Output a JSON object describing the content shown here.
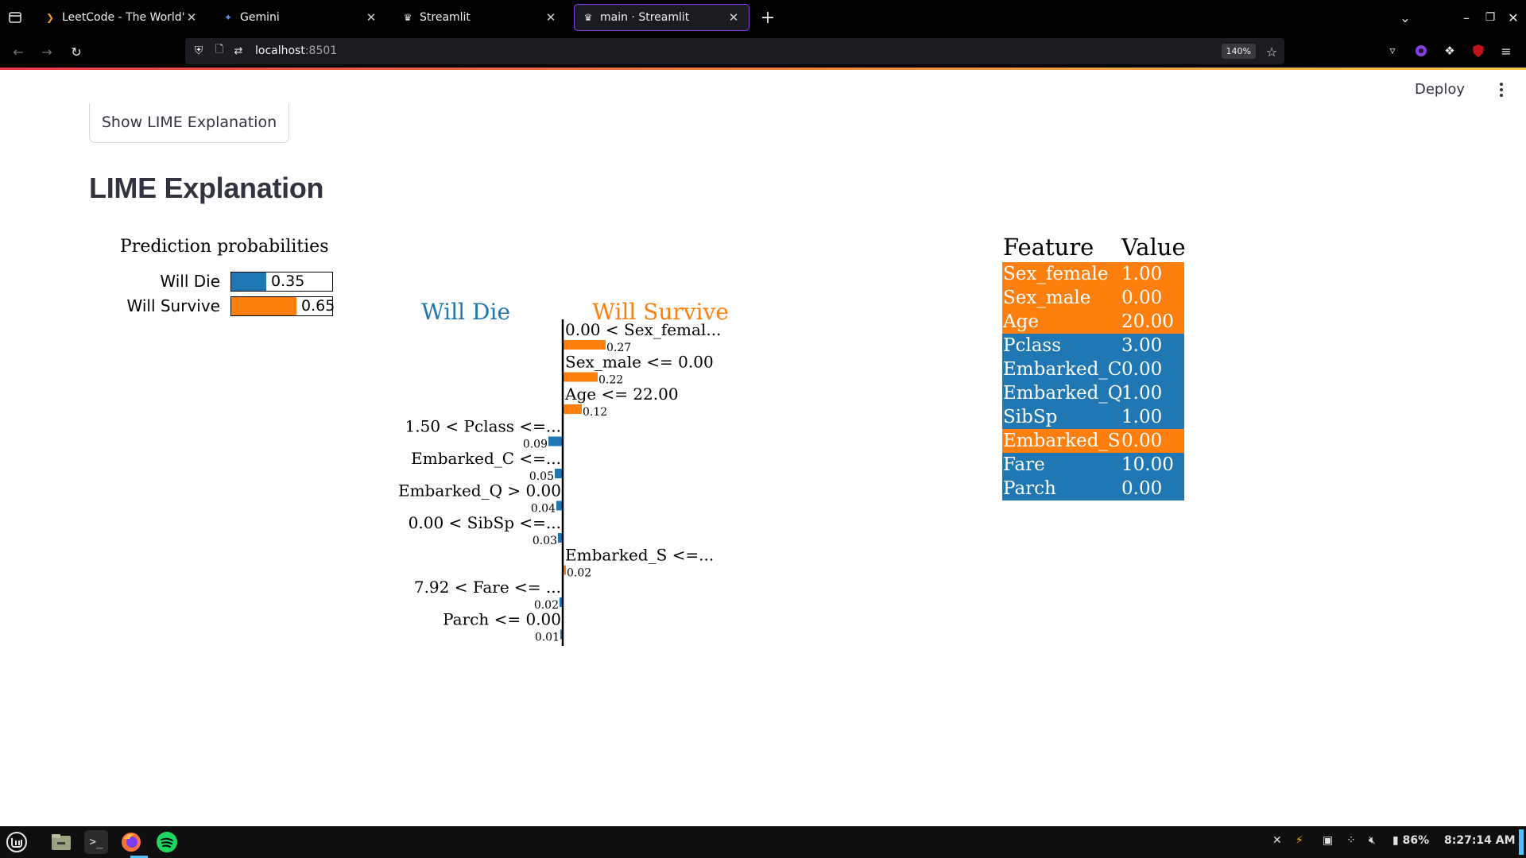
{
  "browser": {
    "tabs": [
      {
        "title": "LeetCode - The World's Leading",
        "favicon": "leetcode-icon"
      },
      {
        "title": "Gemini",
        "favicon": "gemini-icon"
      },
      {
        "title": "Streamlit",
        "favicon": "streamlit-icon"
      },
      {
        "title": "main · Streamlit",
        "favicon": "streamlit-icon"
      }
    ],
    "new_tab": "+",
    "url_host": "localhost",
    "url_port": ":8501",
    "zoom": "140%"
  },
  "app": {
    "deploy_label": "Deploy",
    "lime_button_label": "Show LIME Explanation",
    "heading": "LIME Explanation"
  },
  "lime": {
    "prob_title": "Prediction probabilities",
    "classes": [
      {
        "name": "Will Die",
        "prob": 0.35,
        "prob_label": "0.35",
        "color": "#1f77b4"
      },
      {
        "name": "Will Survive",
        "prob": 0.65,
        "prob_label": "0.65",
        "color": "#ff7f0e"
      }
    ],
    "negative_class": "Will Die",
    "positive_class": "Will Survive",
    "negative_color": "#1f77b4",
    "positive_color": "#ff7f0e"
  },
  "chart_data": {
    "type": "bar",
    "orientation": "horizontal-diverging",
    "categories": [
      "0.00 < Sex_femal...",
      "Sex_male <= 0.00",
      "Age <= 22.00",
      "1.50 < Pclass <=...",
      "Embarked_C <=...",
      "Embarked_Q > 0.00",
      "0.00 < SibSp <=...",
      "Embarked_S <=...",
      "7.92 < Fare <= ...",
      "Parch <= 0.00"
    ],
    "values": [
      0.27,
      0.22,
      0.12,
      -0.09,
      -0.05,
      -0.04,
      -0.03,
      0.02,
      -0.02,
      -0.01
    ],
    "value_labels": [
      "0.27",
      "0.22",
      "0.12",
      "0.09",
      "0.05",
      "0.04",
      "0.03",
      "0.02",
      "0.02",
      "0.01"
    ],
    "series": [
      {
        "name": "Will Die",
        "color": "#1f77b4"
      },
      {
        "name": "Will Survive",
        "color": "#ff7f0e"
      }
    ]
  },
  "feature_table": {
    "headers": [
      "Feature",
      "Value"
    ],
    "rows": [
      {
        "feature": "Sex_female",
        "value": "1.00",
        "color": "#ff7f0e"
      },
      {
        "feature": "Sex_male",
        "value": "0.00",
        "color": "#ff7f0e"
      },
      {
        "feature": "Age",
        "value": "20.00",
        "color": "#ff7f0e"
      },
      {
        "feature": "Pclass",
        "value": "3.00",
        "color": "#1f77b4"
      },
      {
        "feature": "Embarked_C",
        "value": "0.00",
        "color": "#1f77b4"
      },
      {
        "feature": "Embarked_Q",
        "value": "1.00",
        "color": "#1f77b4"
      },
      {
        "feature": "SibSp",
        "value": "1.00",
        "color": "#1f77b4"
      },
      {
        "feature": "Embarked_S",
        "value": "0.00",
        "color": "#ff7f0e"
      },
      {
        "feature": "Fare",
        "value": "10.00",
        "color": "#1f77b4"
      },
      {
        "feature": "Parch",
        "value": "0.00",
        "color": "#1f77b4"
      }
    ]
  },
  "taskbar": {
    "apps": [
      "mint-menu-icon",
      "files-icon",
      "terminal-icon",
      "firefox-icon",
      "spotify-icon"
    ],
    "battery": "86%",
    "time": "8:27:14 AM"
  }
}
